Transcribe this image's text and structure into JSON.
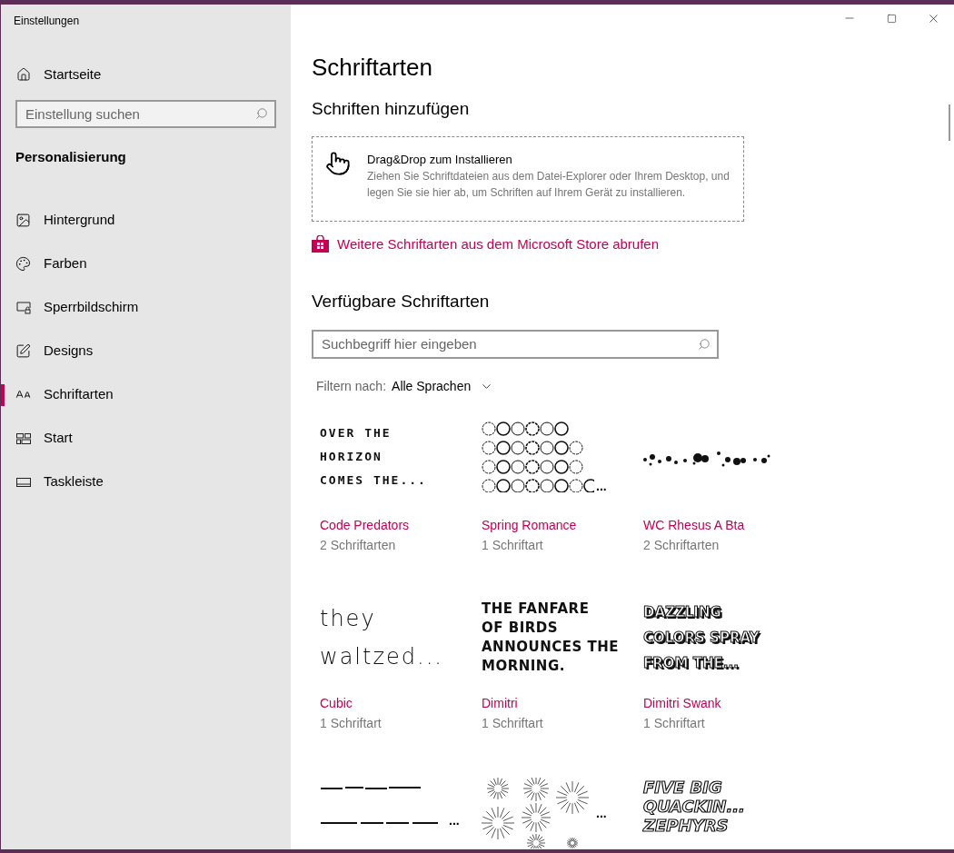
{
  "window": {
    "title": "Einstellungen"
  },
  "sidebar": {
    "home": "Startseite",
    "search": {
      "placeholder": "Einstellung suchen"
    },
    "section": "Personalisierung",
    "items": [
      {
        "label": "Hintergrund",
        "selected": false
      },
      {
        "label": "Farben",
        "selected": false
      },
      {
        "label": "Sperrbildschirm",
        "selected": false
      },
      {
        "label": "Designs",
        "selected": false
      },
      {
        "label": "Schriftarten",
        "selected": true
      },
      {
        "label": "Start",
        "selected": false
      },
      {
        "label": "Taskleiste",
        "selected": false
      }
    ]
  },
  "page": {
    "title": "Schriftarten",
    "add_heading": "Schriften hinzufügen",
    "drop_zone": {
      "title": "Drag&Drop zum Installieren",
      "text": "Ziehen Sie Schriftdateien aus dem Datei-Explorer oder Ihrem Desktop, und legen Sie sie hier ab, um Schriften auf Ihrem Gerät zu installieren."
    },
    "store_link": "Weitere Schriftarten aus dem Microsoft Store abrufen",
    "available_heading": "Verfügbare Schriftarten",
    "search": {
      "placeholder": "Suchbegriff hier eingeben"
    },
    "filter": {
      "label": "Filtern nach:",
      "value": "Alle Sprachen"
    },
    "fonts": [
      {
        "name": "Code Predators",
        "count": "2 Schriftarten",
        "preview": {
          "kind": "techno",
          "lines": [
            "OVER THE",
            "HORIZON",
            "COMES THE..."
          ]
        }
      },
      {
        "name": "Spring Romance",
        "count": "1 Schriftart",
        "preview": {
          "kind": "circles",
          "tail": "..."
        }
      },
      {
        "name": "WC Rhesus A Bta",
        "count": "2 Schriftarten",
        "preview": {
          "kind": "splatter"
        }
      },
      {
        "name": "Cubic",
        "count": "1 Schriftart",
        "preview": {
          "kind": "thin",
          "lines": [
            "they",
            "waltzed..."
          ]
        }
      },
      {
        "name": "Dimitri",
        "count": "1 Schriftart",
        "preview": {
          "kind": "heavy",
          "lines": [
            "THE FANFARE",
            "OF BIRDS",
            "ANNOUNCES THE",
            "MORNING."
          ]
        }
      },
      {
        "name": "Dimitri Swank",
        "count": "1 Schriftart",
        "preview": {
          "kind": "outline",
          "lines": [
            "DAZZLING",
            "COLORS SPRAY",
            "FROM THE..."
          ]
        }
      },
      {
        "preview": {
          "kind": "strokes",
          "tail": "..."
        }
      },
      {
        "preview": {
          "kind": "bursts",
          "tail": "..."
        }
      },
      {
        "preview": {
          "kind": "italic-outline",
          "lines": [
            "FIVE BIG",
            "QUACKIN...",
            "ZEPHYRS"
          ]
        }
      }
    ]
  }
}
